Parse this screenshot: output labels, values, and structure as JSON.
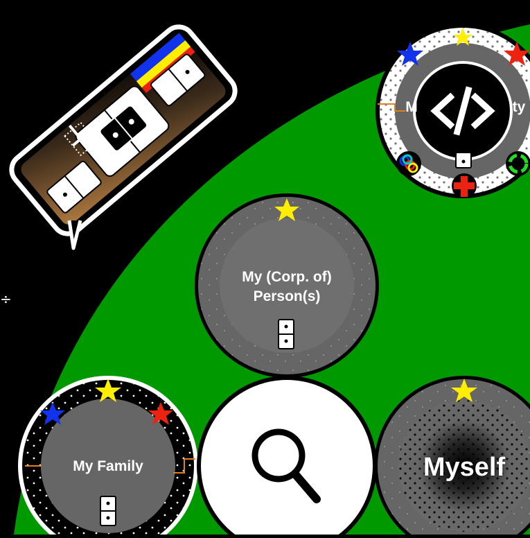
{
  "colors": {
    "background": "#000000",
    "field": "#009900",
    "disc": "#666666",
    "disc_inner": "#6f6f6f",
    "ring_white": "#ffffff",
    "star_yellow": "#ffee00",
    "star_red": "#ee2211",
    "star_blue": "#1133ee"
  },
  "bubbles": {
    "my_person": {
      "label": "My (Corp. of) Person(s)",
      "star": "yellow",
      "domino_icon": "domino-icon"
    },
    "my_family": {
      "label": "My Family",
      "stars": [
        "yellow",
        "blue",
        "red"
      ],
      "domino_icon": "domino-icon"
    },
    "my_community": {
      "label_left": "M",
      "label_right": "ty",
      "center_icon": "code-icon",
      "badges": [
        "rings-icon",
        "plus-icon",
        "recycle-icon"
      ]
    },
    "my_self": {
      "label": "Myself",
      "star": "yellow"
    },
    "search": {
      "icon": "search-icon"
    }
  },
  "domino_card": {
    "icon": "dominoes-icon"
  },
  "side_glyph": "÷"
}
